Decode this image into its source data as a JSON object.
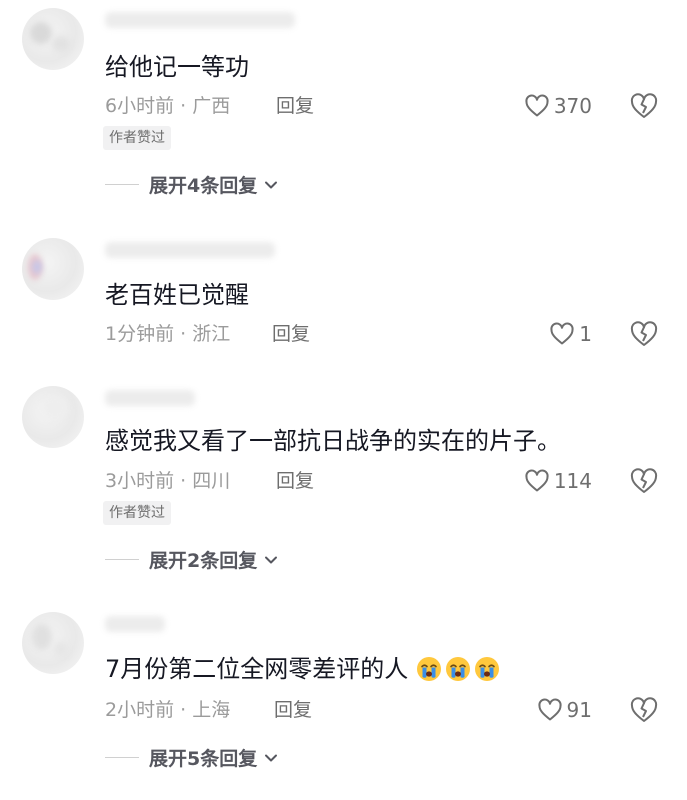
{
  "comments": [
    {
      "text": "给他记一等功",
      "time_location": "6小时前 · 广西",
      "reply_label": "回复",
      "like_count": "370",
      "badge": "作者赞过",
      "expand_label": "展开4条回复"
    },
    {
      "text": "老百姓已觉醒",
      "time_location": "1分钟前 · 浙江",
      "reply_label": "回复",
      "like_count": "1"
    },
    {
      "text": "感觉我又看了一部抗日战争的实在的片子。",
      "time_location": "3小时前 · 四川",
      "reply_label": "回复",
      "like_count": "114",
      "badge": "作者赞过",
      "expand_label": "展开2条回复"
    },
    {
      "text": "7月份第二位全网零差评的人",
      "emojis": [
        "crying-emoji",
        "crying-emoji",
        "crying-emoji"
      ],
      "time_location": "2小时前 · 上海",
      "reply_label": "回复",
      "like_count": "91",
      "expand_label": "展开5条回复"
    }
  ],
  "icons": {
    "like": "heart-outline-icon",
    "dislike": "broken-heart-icon",
    "expand": "chevron-down-icon"
  },
  "colors": {
    "text": "#161823",
    "meta": "#9b9b9b",
    "secondary": "#6e6e6e",
    "badge_bg": "#f1f1f2",
    "emoji_yellow": "#ffc83d",
    "emoji_tears": "#3a8ee6"
  }
}
